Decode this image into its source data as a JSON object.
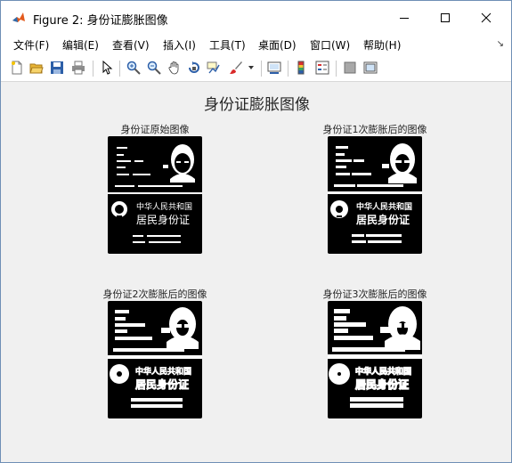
{
  "window": {
    "title": "Figure 2: 身份证膨胀图像",
    "controls": [
      "minimize",
      "maximize",
      "close"
    ]
  },
  "menu": {
    "items": [
      "文件(F)",
      "编辑(E)",
      "查看(V)",
      "插入(I)",
      "工具(T)",
      "桌面(D)",
      "窗口(W)",
      "帮助(H)"
    ],
    "corner": "↘"
  },
  "toolbar": {
    "icons": [
      "new-figure-icon",
      "open-file-icon",
      "save-icon",
      "print-icon",
      "pointer-icon",
      "zoom-in-icon",
      "zoom-out-icon",
      "pan-hand-icon",
      "rotate-3d-icon",
      "data-cursor-icon",
      "brush-icon",
      "dropdown-arrow-icon",
      "link-plot-icon",
      "colorbar-icon",
      "legend-icon",
      "hide-plot-tools-icon",
      "show-plot-tools-icon"
    ]
  },
  "figure": {
    "title": "身份证膨胀图像",
    "subplots": [
      {
        "title": "身份证原始图像",
        "card_front_text": "中华人民共和国",
        "card_front_text2": "居民身份证"
      },
      {
        "title": "身份证1次膨胀后的图像",
        "card_front_text": "中华人民共和国",
        "card_front_text2": "居民身份证"
      },
      {
        "title": "身份证2次膨胀后的图像",
        "card_front_text": "中华人民共和国",
        "card_front_text2": "居民身份证"
      },
      {
        "title": "身份证3次膨胀后的图像",
        "card_front_text": "中华人民共和国",
        "card_front_text2": "居民身份证"
      }
    ]
  },
  "colors": {
    "window_bg": "#f0f0f0",
    "image_bg": "#000000",
    "image_fg": "#ffffff",
    "title_text": "#262626"
  }
}
